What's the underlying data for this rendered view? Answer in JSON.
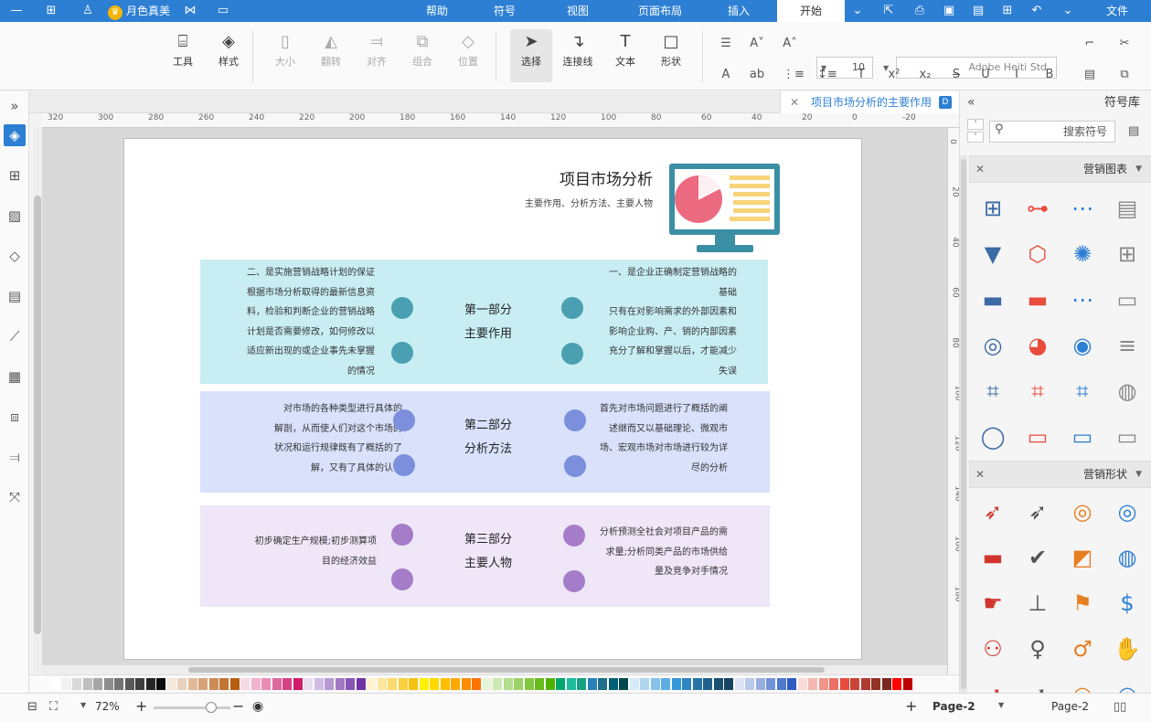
{
  "menubar": {
    "items": [
      "文件",
      "开始",
      "插入",
      "页面布局",
      "视图",
      "符号",
      "帮助"
    ],
    "brand": "月色真美"
  },
  "ribbon": {
    "left_groups": [
      {
        "label": "工具",
        "icon": "tools-icon"
      },
      {
        "label": "样式",
        "icon": "paint-bucket-icon"
      },
      {
        "label": "大小",
        "icon": "size-icon"
      },
      {
        "label": "翻转",
        "icon": "flip-icon"
      },
      {
        "label": "对齐",
        "icon": "align-icon"
      },
      {
        "label": "组合",
        "icon": "group-icon"
      },
      {
        "label": "位置",
        "icon": "layers-icon"
      },
      {
        "label": "选择",
        "icon": "cursor-icon"
      },
      {
        "label": "连接线",
        "icon": "connector-icon"
      },
      {
        "label": "文本",
        "icon": "text-icon"
      },
      {
        "label": "形状",
        "icon": "rectangle-icon"
      }
    ],
    "font_name": "Adobe Heiti Std",
    "font_size": "10"
  },
  "doc_tab": {
    "title": "项目市场分析的主要作用"
  },
  "ruler": {
    "h_labels": [
      "320",
      "300",
      "280",
      "260",
      "240",
      "220",
      "200",
      "180",
      "160",
      "140",
      "120",
      "100",
      "80",
      "60",
      "40",
      "20",
      "0",
      "-20"
    ],
    "v_labels": [
      "0",
      "20",
      "40",
      "60",
      "80",
      "100",
      "120",
      "140",
      "160",
      "180"
    ]
  },
  "diagram": {
    "title": "项目市场分析",
    "subtitle": "主要作用、分析方法、主要人物",
    "sections": [
      {
        "name_line1": "第一部分",
        "name_line2": "主要作用",
        "right_text": [
          "一、是企业正确制定营销战略的",
          "基础",
          "只有在对影响需求的外部因素和",
          "影响企业购、产、销的内部因素",
          "充分了解和掌握以后，才能减少",
          "失误"
        ],
        "left_text": [
          "二、是实施营销战略计划的保证",
          "根据市场分析取得的最新信息资",
          "料，检验和判断企业的营销战略",
          "计划是否需要修改，如何修改以",
          "适应新出现的或企业事先未掌握",
          "的情况"
        ]
      },
      {
        "name_line1": "第二部分",
        "name_line2": "分析方法",
        "right_text": [
          "首先对市场问题进行了概括的阐",
          "述继而又以基础理论、微观市",
          "场、宏观市场对市场进行较为详",
          "尽的分析"
        ],
        "left_text": [
          "对市场的各种类型进行具体的",
          "解剖，从而使人们对这个市场的",
          "状况和运行规律既有了概括的了",
          "解，又有了具体的认识"
        ]
      },
      {
        "name_line1": "第三部分",
        "name_line2": "主要人物",
        "right_text": [
          "分析预测全社会对项目产品的需",
          "求量;分析同类产品的市场供给",
          "量及竞争对手情况"
        ],
        "left_text": [
          "初步确定生产规模;初步测算项",
          "目的经济效益"
        ]
      }
    ],
    "colors": {
      "band1": "#c8eef4",
      "dot1": "#4aa0b0",
      "band2": "#d9e1fb",
      "dot2": "#7b8fdc",
      "band3": "#efe6f8",
      "dot3": "#a47cc8",
      "monitor": "#3b8fa5",
      "pie": "#ec6a80",
      "bars": "#f7d37a"
    }
  },
  "right_panel": {
    "title": "符号库",
    "search_placeholder": "搜索符号",
    "sections": [
      {
        "title": "营销图表"
      },
      {
        "title": "营销形状"
      }
    ]
  },
  "statusbar": {
    "page_indicator": "Page-2",
    "page_tab": "Page-2",
    "zoom": "72%"
  }
}
